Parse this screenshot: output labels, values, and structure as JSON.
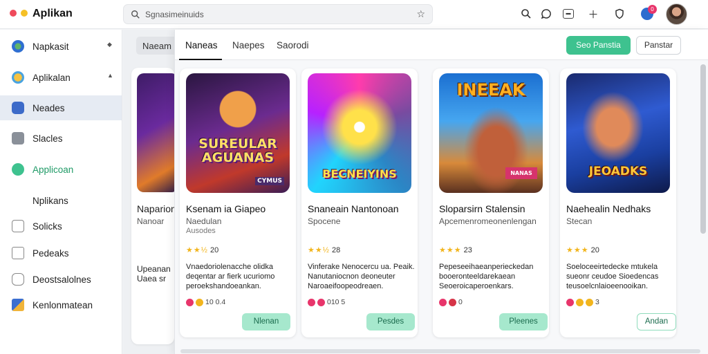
{
  "app": {
    "title": "Aplikan"
  },
  "search": {
    "text": "Sgnasimeinuids"
  },
  "topbar_icons": [
    "search-icon",
    "chat-icon",
    "window-icon",
    "add-icon",
    "shield-icon",
    "notification-icon"
  ],
  "notification": {
    "count": "0"
  },
  "sidebar": {
    "items": [
      {
        "label": "Napkasit",
        "icon": "globe-icon",
        "chevron": "◆"
      },
      {
        "label": "Aplikalan",
        "icon": "smile-icon",
        "chevron": "▲"
      },
      {
        "label": "Neades",
        "icon": "gear-icon",
        "active": true
      },
      {
        "label": "Slacles",
        "icon": "puzzle-icon"
      },
      {
        "label": "Applicoan",
        "icon": "check-icon",
        "green": true
      },
      {
        "label": "Nplikans",
        "icon": ""
      },
      {
        "label": "Solicks",
        "icon": "box-icon"
      },
      {
        "label": "Pedeaks",
        "icon": "folder-icon"
      },
      {
        "label": "Deostsalolnes",
        "icon": "lock-icon"
      },
      {
        "label": "Kenlonmatean",
        "icon": "brand-icon"
      }
    ]
  },
  "background": {
    "pill": "Naeam",
    "card_title": "Naparion",
    "card_sub": "Nanoar",
    "card_desc1": "Upeanan",
    "card_desc2": "Uaea sr"
  },
  "panel": {
    "tabs": [
      "Naneas",
      "Naepes",
      "Saorodi"
    ],
    "primary_button": "Seo Panstia",
    "secondary_button": "Panstar",
    "cards": [
      {
        "art_text": "SUREULAR AGUANAS",
        "art_badge": "CYMUS",
        "title": "Ksenam ia Giapeo",
        "sub": "Naedulan",
        "sub2": "Ausodes",
        "rating": "20",
        "desc": "Vnaedoriolenacche olidka deqentar ar fierk ucuriomo peroekshandoeankan.",
        "meta": "10  0.4",
        "action": "Nlenan",
        "action_style": "filled"
      },
      {
        "art_text": "BECNEIYINS",
        "art_badge": "",
        "title": "Snaneain Nantonoan",
        "sub": "Spocene",
        "sub2": "",
        "rating": "28",
        "desc": "Vinferake Nenocercu ua. Peaik. Nanutaniocnon deoneuter Naroaeifoopeodreaen.",
        "meta": "010  5",
        "action": "Pesdes",
        "action_style": "filled"
      },
      {
        "art_text": "INEEAK",
        "art_badge": "NANAS",
        "title": "Sloparsirn Stalensin",
        "sub": "Apcemenromeonenlengan",
        "sub2": "",
        "rating": "23",
        "desc": "Pepeseeihaeanperieckedan booeronteeldarekaean Seoeroicaperoenkars.",
        "meta": "0",
        "action": "Pleenes",
        "action_style": "filled"
      },
      {
        "art_text": "JEOADKS",
        "art_badge": "",
        "title": "Naehealin Nedhaks",
        "sub": "Stecan",
        "sub2": "",
        "rating": "20",
        "desc": "Soeloceeirtedecke mtukela sueonr ceudoe Sioedencas teusoelcnlaioeenooikan.",
        "meta": "3",
        "action": "Andan",
        "action_style": "outline"
      }
    ]
  },
  "colors": {
    "accent_green": "#3ec28f",
    "action_green_light": "#a6e8cd",
    "star": "#f2b51d",
    "active_sidebar": "#e6ebf3"
  }
}
